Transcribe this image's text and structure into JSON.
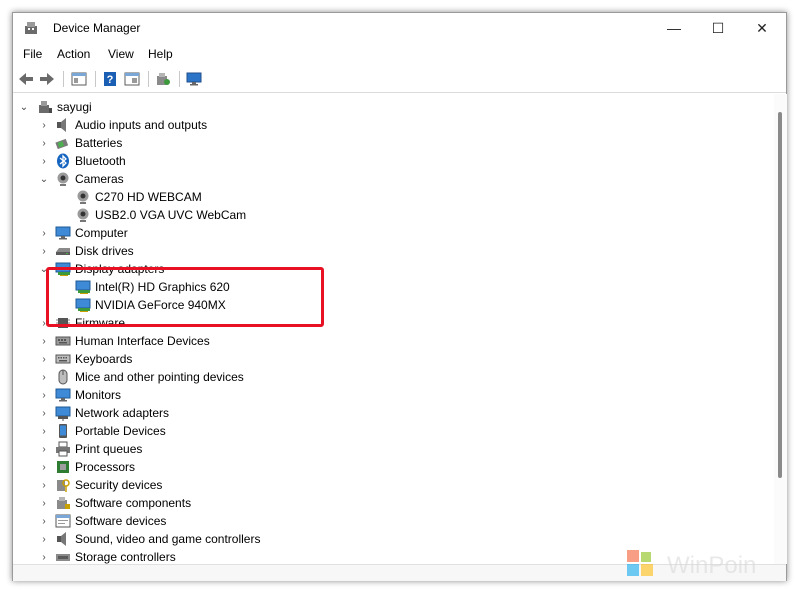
{
  "window": {
    "title": "Device Manager",
    "minimize_glyph": "—",
    "maximize_glyph": "☐",
    "close_glyph": "✕"
  },
  "menu": [
    {
      "label": "File"
    },
    {
      "label": "Action"
    },
    {
      "label": "View"
    },
    {
      "label": "Help"
    }
  ],
  "toolbar": [
    {
      "name": "back-icon"
    },
    {
      "name": "forward-icon"
    },
    {
      "name": "properties-icon"
    },
    {
      "name": "help-icon"
    },
    {
      "name": "view-icon"
    },
    {
      "name": "scan-hardware-icon"
    },
    {
      "name": "monitor-icon"
    }
  ],
  "tree": {
    "root": "sayugi",
    "items": [
      {
        "label": "Audio inputs and outputs",
        "icon": "speaker-icon",
        "expanded": false
      },
      {
        "label": "Batteries",
        "icon": "battery-icon",
        "expanded": false
      },
      {
        "label": "Bluetooth",
        "icon": "bluetooth-icon",
        "expanded": false
      },
      {
        "label": "Cameras",
        "icon": "camera-icon",
        "expanded": true,
        "children": [
          {
            "label": "C270 HD WEBCAM",
            "icon": "webcam-icon"
          },
          {
            "label": "USB2.0 VGA UVC WebCam",
            "icon": "webcam-icon"
          }
        ]
      },
      {
        "label": "Computer",
        "icon": "computer-icon",
        "expanded": false
      },
      {
        "label": "Disk drives",
        "icon": "disk-drive-icon",
        "expanded": false
      },
      {
        "label": "Display adapters",
        "icon": "display-adapter-icon",
        "expanded": true,
        "children": [
          {
            "label": "Intel(R) HD Graphics 620",
            "icon": "display-adapter-icon"
          },
          {
            "label": "NVIDIA GeForce 940MX",
            "icon": "display-adapter-icon"
          }
        ]
      },
      {
        "label": "Firmware",
        "icon": "firmware-icon",
        "expanded": false
      },
      {
        "label": "Human Interface Devices",
        "icon": "hid-icon",
        "expanded": false
      },
      {
        "label": "Keyboards",
        "icon": "keyboard-icon",
        "expanded": false
      },
      {
        "label": "Mice and other pointing devices",
        "icon": "mouse-icon",
        "expanded": false
      },
      {
        "label": "Monitors",
        "icon": "monitor-icon",
        "expanded": false
      },
      {
        "label": "Network adapters",
        "icon": "network-adapter-icon",
        "expanded": false
      },
      {
        "label": "Portable Devices",
        "icon": "portable-device-icon",
        "expanded": false
      },
      {
        "label": "Print queues",
        "icon": "printer-icon",
        "expanded": false
      },
      {
        "label": "Processors",
        "icon": "processor-icon",
        "expanded": false
      },
      {
        "label": "Security devices",
        "icon": "security-key-icon",
        "expanded": false
      },
      {
        "label": "Software components",
        "icon": "software-component-icon",
        "expanded": false
      },
      {
        "label": "Software devices",
        "icon": "software-device-icon",
        "expanded": false
      },
      {
        "label": "Sound, video and game controllers",
        "icon": "sound-icon",
        "expanded": false
      },
      {
        "label": "Storage controllers",
        "icon": "storage-controller-icon",
        "expanded": false
      }
    ]
  },
  "colors": {
    "highlight": "#e81123",
    "accent": "#1a73c9"
  },
  "watermark": {
    "text": "WinPoin"
  }
}
